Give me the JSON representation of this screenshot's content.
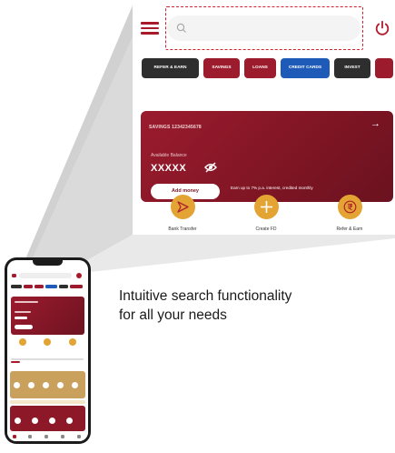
{
  "zoom": {
    "search_placeholder": "",
    "tabs": [
      {
        "label": "Refer & Earn",
        "style": "dark",
        "w": 0
      },
      {
        "label": "Savings",
        "style": "red"
      },
      {
        "label": "Loans",
        "style": "red"
      },
      {
        "label": "Credit Cards",
        "style": "blue"
      },
      {
        "label": "Invest",
        "style": "dark"
      },
      {
        "label": "",
        "style": "red"
      }
    ],
    "card": {
      "account_label": "SAVINGS 12342345678",
      "balance_label": "Available Balance",
      "balance_value": "XXXXX",
      "add_money_label": "Add money",
      "earn_text": "Earn up to 7% p.a. interest, credited monthly"
    },
    "quick_actions": [
      {
        "label": "Bank Transfer",
        "icon": "send-icon"
      },
      {
        "label": "Create FD",
        "icon": "plus-icon"
      },
      {
        "label": "Refer & Earn",
        "icon": "rupee-icon"
      }
    ]
  },
  "caption": {
    "line1": "Intuitive search functionality",
    "line2": "for all your needs"
  },
  "colors": {
    "brand_red": "#9c1b2d",
    "accent_gold": "#e3a434",
    "highlight_red": "#d1202f"
  }
}
